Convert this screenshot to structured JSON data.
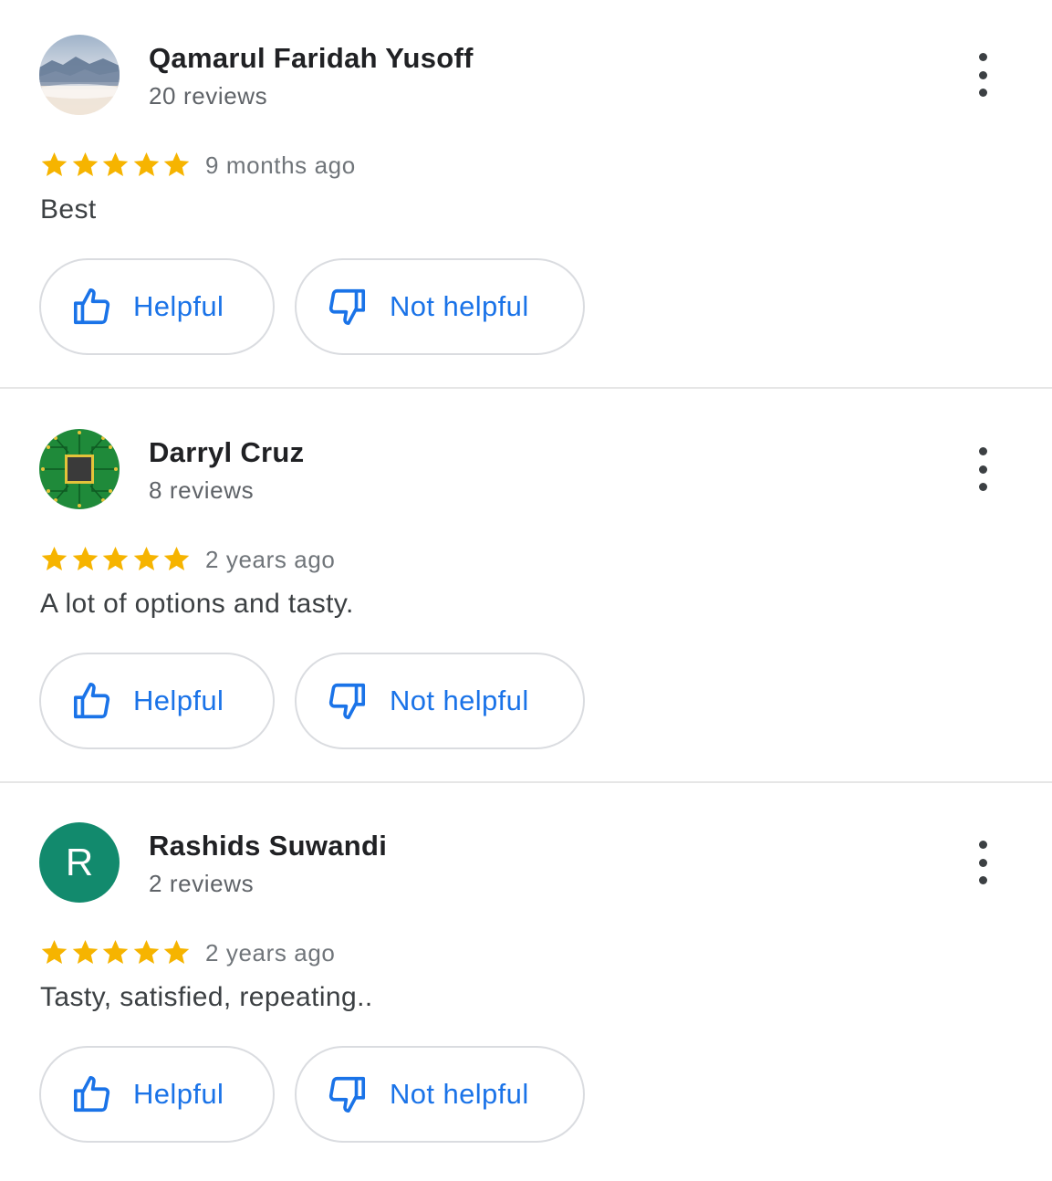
{
  "reviews": [
    {
      "name": "Qamarul Faridah Yusoff",
      "count": "20 reviews",
      "avatar_type": "landscape-photo",
      "stars": 5,
      "time": "9 months ago",
      "text": "Best",
      "helpful_label": "Helpful",
      "not_helpful_label": "Not helpful"
    },
    {
      "name": "Darryl Cruz",
      "count": "8 reviews",
      "avatar_type": "circuit-chip-photo",
      "stars": 5,
      "time": "2 years ago",
      "text": "A lot of options and tasty.",
      "helpful_label": "Helpful",
      "not_helpful_label": "Not helpful"
    },
    {
      "name": "Rashids Suwandi",
      "count": "2 reviews",
      "avatar_type": "letter",
      "avatar_letter": "R",
      "avatar_color": "#128a6d",
      "stars": 5,
      "time": "2 years ago",
      "text": "Tasty, satisfied, repeating..",
      "helpful_label": "Helpful",
      "not_helpful_label": "Not helpful"
    }
  ],
  "colors": {
    "star": "#f6b400",
    "link_blue": "#1a73e8",
    "divider": "#e6e6e6"
  },
  "icons": [
    "star-icon",
    "thumb-up-icon",
    "thumb-down-icon",
    "more-vert-icon"
  ]
}
